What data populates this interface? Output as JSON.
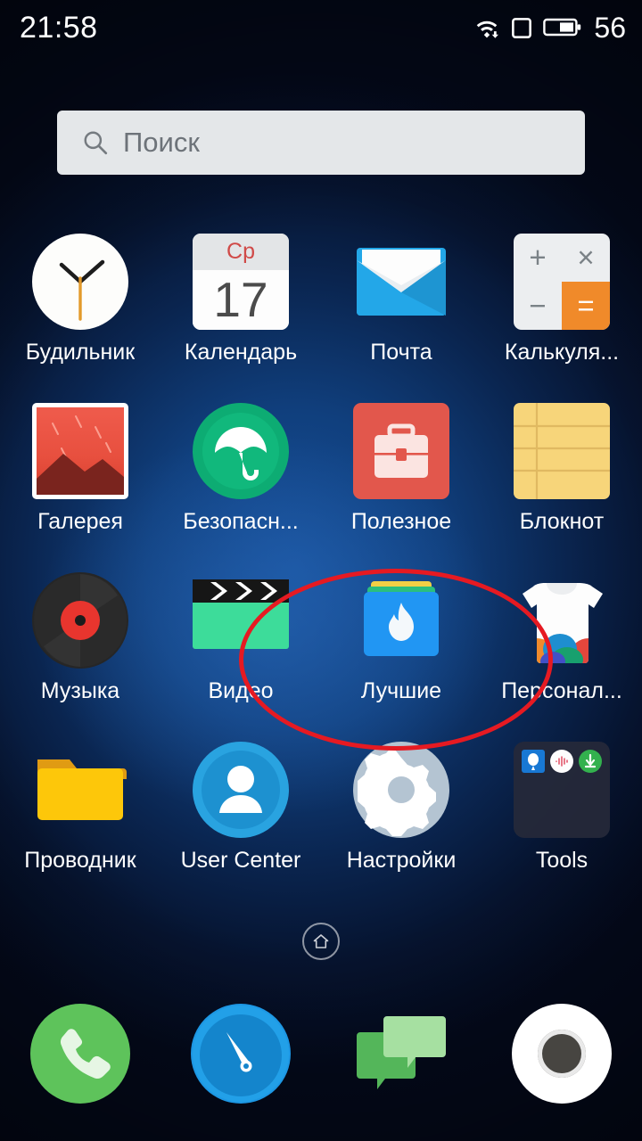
{
  "status_bar": {
    "time": "21:58",
    "battery_percent": "56",
    "icons": [
      "wifi-download-icon",
      "sim-card-icon",
      "battery-icon"
    ]
  },
  "search": {
    "placeholder": "Поиск",
    "icon": "search-icon"
  },
  "apps": [
    {
      "label": "Будильник",
      "icon": "clock-icon"
    },
    {
      "label": "Календарь",
      "icon": "calendar-icon",
      "weekday": "Ср",
      "day": "17"
    },
    {
      "label": "Почта",
      "icon": "mail-icon"
    },
    {
      "label": "Калькуля...",
      "icon": "calculator-icon",
      "keys": [
        "+",
        "×",
        "−",
        "="
      ]
    },
    {
      "label": "Галерея",
      "icon": "gallery-icon"
    },
    {
      "label": "Безопасн...",
      "icon": "umbrella-security-icon"
    },
    {
      "label": "Полезное",
      "icon": "briefcase-icon"
    },
    {
      "label": "Блокнот",
      "icon": "notepad-icon"
    },
    {
      "label": "Музыка",
      "icon": "vinyl-record-icon"
    },
    {
      "label": "Видео",
      "icon": "clapperboard-icon"
    },
    {
      "label": "Лучшие",
      "icon": "flame-folder-icon"
    },
    {
      "label": "Персонал...",
      "icon": "tshirt-themes-icon"
    },
    {
      "label": "Проводник",
      "icon": "folder-icon"
    },
    {
      "label": "User Center",
      "icon": "user-avatar-icon"
    },
    {
      "label": "Настройки",
      "icon": "gear-icon"
    },
    {
      "label": "Tools",
      "icon": "folder-group-icon"
    }
  ],
  "dock": [
    {
      "label": "phone",
      "icon": "phone-icon"
    },
    {
      "label": "browser",
      "icon": "compass-browser-icon"
    },
    {
      "label": "sms",
      "icon": "message-bubbles-icon"
    },
    {
      "label": "camera",
      "icon": "camera-icon"
    }
  ],
  "home_indicator": {
    "icon": "home-icon"
  },
  "annotation": {
    "shape": "ellipse",
    "color": "#e61a22",
    "target_app_label": "Лучшие"
  },
  "colors": {
    "accent_red": "#e61a22",
    "search_bg": "#e4e7e9",
    "label_text": "#ffffff",
    "wallpaper_core": "#17519c"
  }
}
